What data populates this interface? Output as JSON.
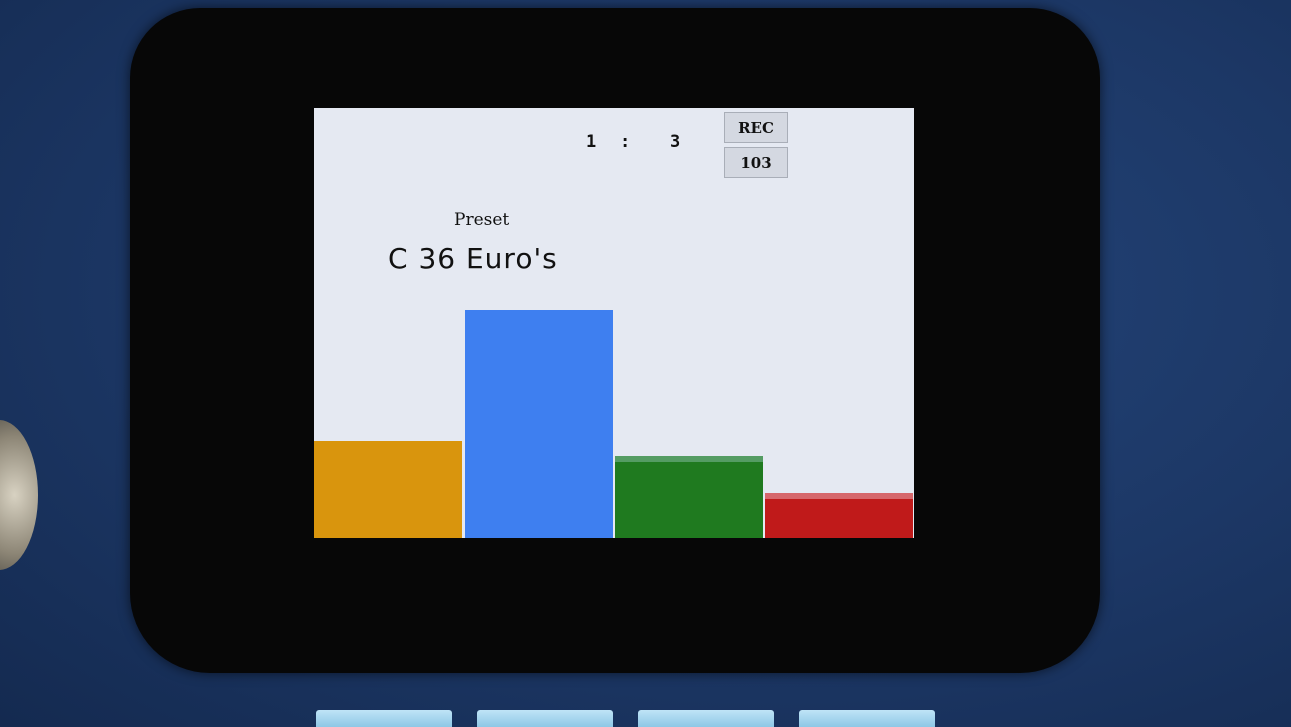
{
  "top": {
    "counter_left": "1",
    "counter_sep": ":",
    "counter_right": "3",
    "rec_label": "REC",
    "value_label": "103"
  },
  "preset": {
    "caption": "Preset",
    "name": "C 36 Euro's"
  },
  "level_bars": [
    {
      "name": "bar-1",
      "level": 0.225,
      "color": "#d9950d",
      "cap_color": "#d9950d"
    },
    {
      "name": "bar-2",
      "level": 0.53,
      "color": "#3e7ff0",
      "cap_color": "#3e7ff0"
    },
    {
      "name": "bar-3",
      "level": 0.19,
      "color": "#1f7a1f",
      "cap_color": "#7fb89a"
    },
    {
      "name": "bar-4",
      "level": 0.105,
      "color": "#c01a1a",
      "cap_color": "#e8a7b0"
    }
  ],
  "colors": {
    "screen_bg": "#e5e9f2",
    "bezel": "#070707",
    "panel": "#1c3765"
  }
}
